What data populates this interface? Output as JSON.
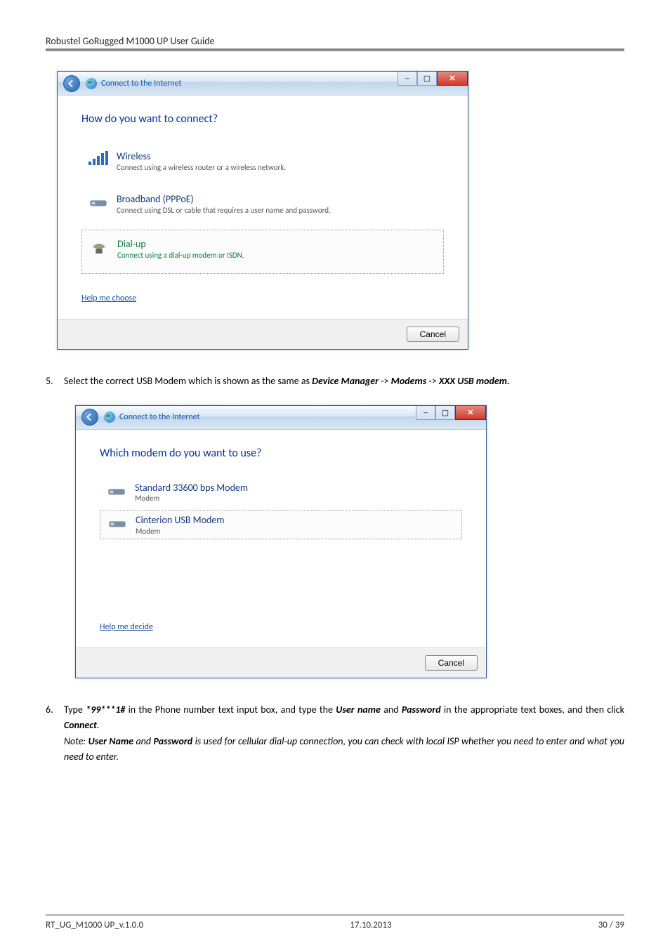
{
  "header": {
    "title": "Robustel GoRugged M1000 UP User Guide"
  },
  "dialog1": {
    "title": "Connect to the Internet",
    "heading": "How do you want to connect?",
    "options": [
      {
        "title": "Wireless",
        "desc": "Connect using a wireless router or a wireless network."
      },
      {
        "title": "Broadband (PPPoE)",
        "desc": "Connect using DSL or cable that requires a user name and password."
      },
      {
        "title": "Dial-up",
        "desc": "Connect using a dial-up modem or ISDN."
      }
    ],
    "help": "Help me choose",
    "cancel": "Cancel"
  },
  "step5": {
    "num": "5.",
    "pre": "Select the correct USB Modem which is shown as the same as ",
    "dm": "Device Manager",
    "arrow1": " -> ",
    "modems": "Modems",
    "arrow2": " -> ",
    "xxx": "XXX USB modem."
  },
  "dialog2": {
    "title": "Connect to the Internet",
    "heading": "Which modem do you want to use?",
    "options": [
      {
        "title": "Standard 33600 bps Modem",
        "desc": "Modem"
      },
      {
        "title": "Cinterion USB Modem",
        "desc": "Modem"
      }
    ],
    "help": "Help me decide",
    "cancel": "Cancel"
  },
  "step6": {
    "num": "6.",
    "t1": "Type ",
    "code": "*99***1#",
    "t2": " in the Phone number text input box, and type the ",
    "un": "User name",
    "t3": " and ",
    "pw": "Password",
    "t4": " in the appropriate text boxes, and then click ",
    "conn": "Connect",
    "t5": ".",
    "note1": "Note: ",
    "nun": "User Name",
    "note2": " and ",
    "npw": "Password",
    "note3": " is used for cellular dial-up connection, you can check with local ISP whether you need to enter and what you need to enter."
  },
  "footer": {
    "left": "RT_UG_M1000 UP_v.1.0.0",
    "center": "17.10.2013",
    "right": "30 / 39"
  }
}
